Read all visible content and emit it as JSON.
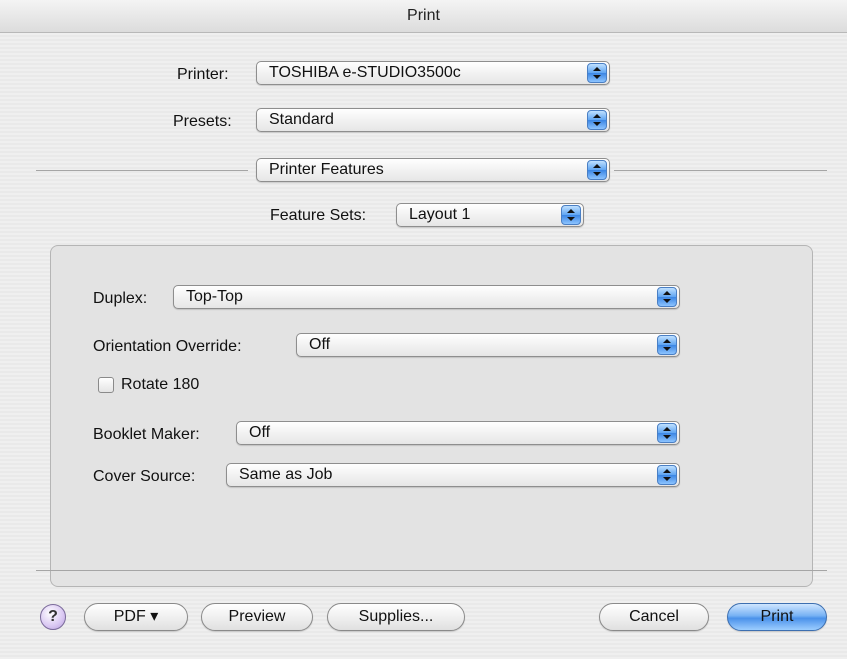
{
  "window": {
    "title": "Print"
  },
  "printer": {
    "label": "Printer:",
    "value": "TOSHIBA e-STUDIO3500c"
  },
  "presets": {
    "label": "Presets:",
    "value": "Standard"
  },
  "panel": {
    "value": "Printer Features"
  },
  "feature_sets": {
    "label": "Feature Sets:",
    "value": "Layout 1"
  },
  "options": {
    "duplex": {
      "label": "Duplex:",
      "value": "Top-Top"
    },
    "orientation_override": {
      "label": "Orientation Override:",
      "value": "Off"
    },
    "rotate_180": {
      "label": "Rotate 180",
      "checked": false
    },
    "booklet_maker": {
      "label": "Booklet Maker:",
      "value": "Off"
    },
    "cover_source": {
      "label": "Cover Source:",
      "value": "Same as Job"
    }
  },
  "footer": {
    "help": "?",
    "pdf": "PDF ▾",
    "preview": "Preview",
    "supplies": "Supplies...",
    "cancel": "Cancel",
    "print": "Print"
  },
  "colors": {
    "default_button": "#4b92ea",
    "popup_arrow": "#3b86e4"
  }
}
